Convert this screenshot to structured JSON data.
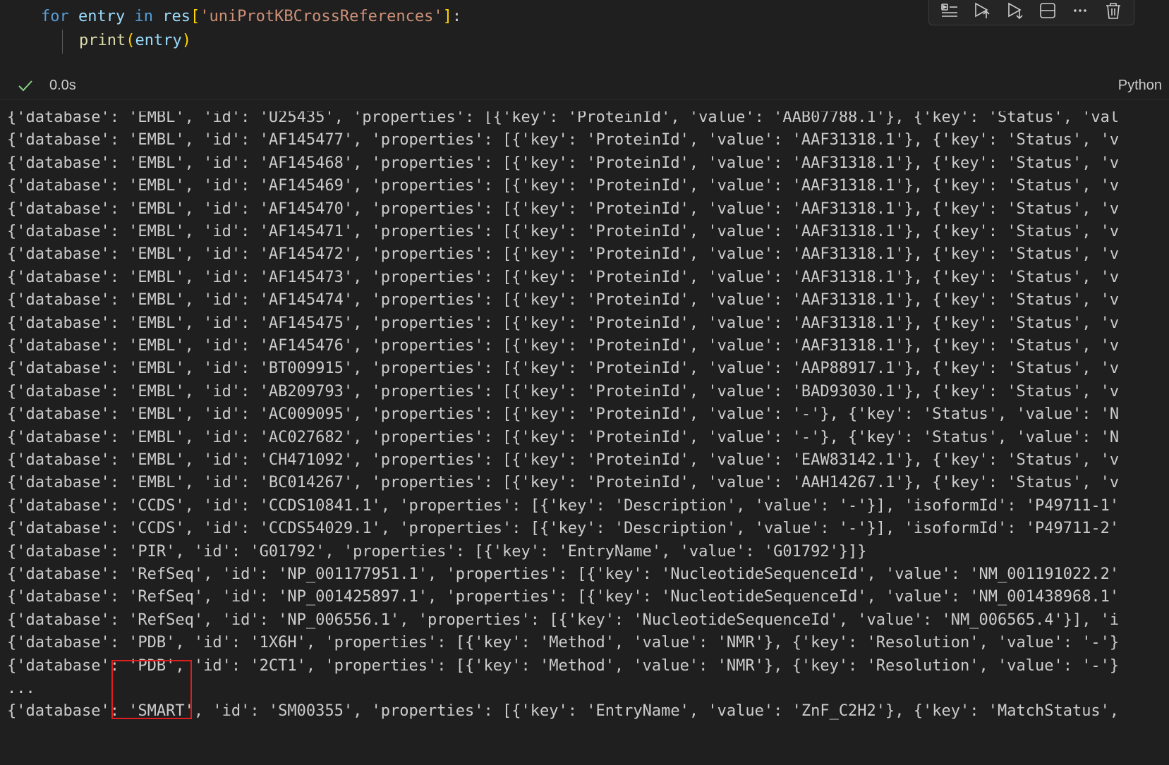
{
  "code": {
    "line1": {
      "kw_for": "for",
      "var_entry": " entry ",
      "kw_in": "in",
      "var_res": " res",
      "open": "[",
      "key": "'uniProtKBCrossReferences'",
      "close": "]",
      "colon": ":"
    },
    "line2": {
      "fn_print": "print",
      "open": "(",
      "arg": "entry",
      "close": ")"
    }
  },
  "toolbar": {
    "icons": [
      "run-by-line-icon",
      "execute-above-icon",
      "execute-below-icon",
      "split-cell-icon",
      "more-actions-icon",
      "delete-cell-icon"
    ]
  },
  "status": {
    "exec_time": "0.0s",
    "language": "Python",
    "success_color": "#89d185"
  },
  "output_lines": [
    "{'database': 'EMBL', 'id': 'U25435', 'properties': [{'key': 'ProteinId', 'value': 'AAB07788.1'}, {'key': 'Status', 'val",
    "{'database': 'EMBL', 'id': 'AF145477', 'properties': [{'key': 'ProteinId', 'value': 'AAF31318.1'}, {'key': 'Status', 'v",
    "{'database': 'EMBL', 'id': 'AF145468', 'properties': [{'key': 'ProteinId', 'value': 'AAF31318.1'}, {'key': 'Status', 'v",
    "{'database': 'EMBL', 'id': 'AF145469', 'properties': [{'key': 'ProteinId', 'value': 'AAF31318.1'}, {'key': 'Status', 'v",
    "{'database': 'EMBL', 'id': 'AF145470', 'properties': [{'key': 'ProteinId', 'value': 'AAF31318.1'}, {'key': 'Status', 'v",
    "{'database': 'EMBL', 'id': 'AF145471', 'properties': [{'key': 'ProteinId', 'value': 'AAF31318.1'}, {'key': 'Status', 'v",
    "{'database': 'EMBL', 'id': 'AF145472', 'properties': [{'key': 'ProteinId', 'value': 'AAF31318.1'}, {'key': 'Status', 'v",
    "{'database': 'EMBL', 'id': 'AF145473', 'properties': [{'key': 'ProteinId', 'value': 'AAF31318.1'}, {'key': 'Status', 'v",
    "{'database': 'EMBL', 'id': 'AF145474', 'properties': [{'key': 'ProteinId', 'value': 'AAF31318.1'}, {'key': 'Status', 'v",
    "{'database': 'EMBL', 'id': 'AF145475', 'properties': [{'key': 'ProteinId', 'value': 'AAF31318.1'}, {'key': 'Status', 'v",
    "{'database': 'EMBL', 'id': 'AF145476', 'properties': [{'key': 'ProteinId', 'value': 'AAF31318.1'}, {'key': 'Status', 'v",
    "{'database': 'EMBL', 'id': 'BT009915', 'properties': [{'key': 'ProteinId', 'value': 'AAP88917.1'}, {'key': 'Status', 'v",
    "{'database': 'EMBL', 'id': 'AB209793', 'properties': [{'key': 'ProteinId', 'value': 'BAD93030.1'}, {'key': 'Status', 'v",
    "{'database': 'EMBL', 'id': 'AC009095', 'properties': [{'key': 'ProteinId', 'value': '-'}, {'key': 'Status', 'value': 'N",
    "{'database': 'EMBL', 'id': 'AC027682', 'properties': [{'key': 'ProteinId', 'value': '-'}, {'key': 'Status', 'value': 'N",
    "{'database': 'EMBL', 'id': 'CH471092', 'properties': [{'key': 'ProteinId', 'value': 'EAW83142.1'}, {'key': 'Status', 'v",
    "{'database': 'EMBL', 'id': 'BC014267', 'properties': [{'key': 'ProteinId', 'value': 'AAH14267.1'}, {'key': 'Status', 'v",
    "{'database': 'CCDS', 'id': 'CCDS10841.1', 'properties': [{'key': 'Description', 'value': '-'}], 'isoformId': 'P49711-1'",
    "{'database': 'CCDS', 'id': 'CCDS54029.1', 'properties': [{'key': 'Description', 'value': '-'}], 'isoformId': 'P49711-2'",
    "{'database': 'PIR', 'id': 'G01792', 'properties': [{'key': 'EntryName', 'value': 'G01792'}]}",
    "{'database': 'RefSeq', 'id': 'NP_001177951.1', 'properties': [{'key': 'NucleotideSequenceId', 'value': 'NM_001191022.2'",
    "{'database': 'RefSeq', 'id': 'NP_001425897.1', 'properties': [{'key': 'NucleotideSequenceId', 'value': 'NM_001438968.1'",
    "{'database': 'RefSeq', 'id': 'NP_006556.1', 'properties': [{'key': 'NucleotideSequenceId', 'value': 'NM_006565.4'}], 'i",
    "{'database': 'PDB', 'id': '1X6H', 'properties': [{'key': 'Method', 'value': 'NMR'}, {'key': 'Resolution', 'value': '-'}",
    "{'database': 'PDB', 'id': '2CT1', 'properties': [{'key': 'Method', 'value': 'NMR'}, {'key': 'Resolution', 'value': '-'}",
    "...",
    "{'database': 'SMART', 'id': 'SM00355', 'properties': [{'key': 'EntryName', 'value': 'ZnF_C2H2'}, {'key': 'MatchStatus', "
  ],
  "annotation_color": "#e01e1e"
}
